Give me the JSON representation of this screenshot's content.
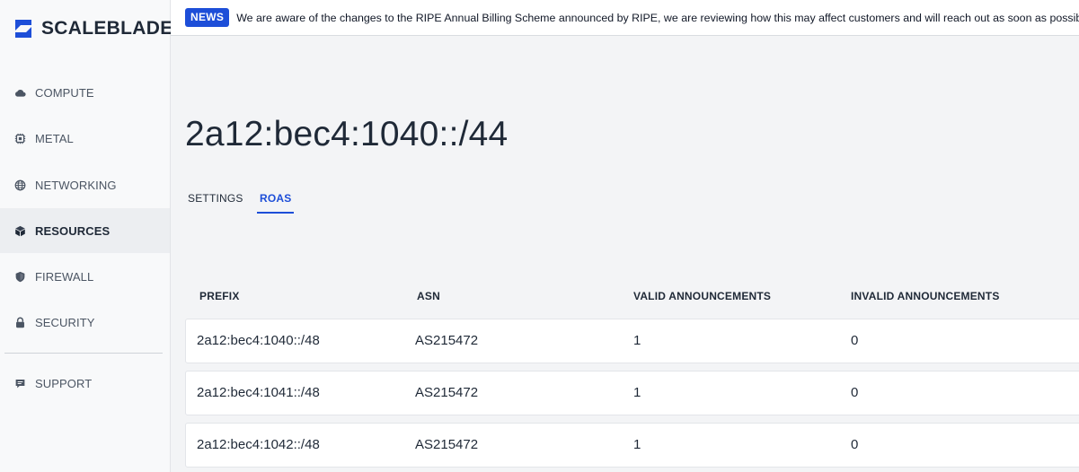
{
  "brand": {
    "name": "SCALEBLADE",
    "logo_icon": "scaleblade-logo-icon",
    "accent": "#1d4ed8"
  },
  "sidebar": {
    "items": [
      {
        "label": "COMPUTE",
        "icon": "cloud-icon"
      },
      {
        "label": "METAL",
        "icon": "chip-icon"
      },
      {
        "label": "NETWORKING",
        "icon": "globe-icon"
      },
      {
        "label": "RESOURCES",
        "icon": "cube-icon",
        "active": true
      },
      {
        "label": "FIREWALL",
        "icon": "shield-icon"
      },
      {
        "label": "SECURITY",
        "icon": "lock-icon"
      },
      {
        "label": "SUPPORT",
        "icon": "chat-icon"
      }
    ]
  },
  "news": {
    "badge": "NEWS",
    "text": "We are aware of the changes to the RIPE Annual Billing Scheme announced by RIPE, we are reviewing how this may affect customers and will reach out as soon as possible."
  },
  "page": {
    "title": "2a12:bec4:1040::/44"
  },
  "tabs": [
    {
      "label": "SETTINGS",
      "active": false
    },
    {
      "label": "ROAS",
      "active": true
    }
  ],
  "table": {
    "headers": [
      "PREFIX",
      "ASN",
      "VALID ANNOUNCEMENTS",
      "INVALID ANNOUNCEMENTS"
    ],
    "rows": [
      {
        "prefix": "2a12:bec4:1040::/48",
        "asn": "AS215472",
        "valid": "1",
        "invalid": "0"
      },
      {
        "prefix": "2a12:bec4:1041::/48",
        "asn": "AS215472",
        "valid": "1",
        "invalid": "0"
      },
      {
        "prefix": "2a12:bec4:1042::/48",
        "asn": "AS215472",
        "valid": "1",
        "invalid": "0"
      }
    ]
  }
}
